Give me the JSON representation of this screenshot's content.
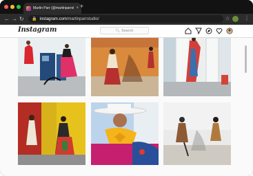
{
  "browser": {
    "tab_title": "Martin Parr (@martinparrstudio)",
    "tab_close": "×",
    "new_tab": "+",
    "url_host": "instagram.com",
    "url_path": "/martinparrstudio/",
    "back": "←",
    "forward": "→",
    "reload": "↻",
    "lock": "🔒",
    "bookmark": "☆",
    "menu": "⋮",
    "traffic_lights": [
      "#fe5f57",
      "#febc2e",
      "#28c840"
    ]
  },
  "instagram": {
    "logo": "Instagram",
    "search_placeholder": "Search",
    "nav_icons": [
      "home-icon",
      "send-icon",
      "explore-icon",
      "heart-icon",
      "profile-avatar"
    ]
  },
  "posts": [
    {
      "name": "post-red-dress-gas-pump",
      "palette": [
        "#e9eef1",
        "#d9262f",
        "#234a7a"
      ]
    },
    {
      "name": "post-women-shadow-wall",
      "palette": [
        "#d98a3d",
        "#b5302e",
        "#f1e4cf"
      ]
    },
    {
      "name": "post-white-doors",
      "palette": [
        "#ecefee",
        "#d2403a",
        "#3a6fb0"
      ]
    },
    {
      "name": "post-yellow-wall",
      "palette": [
        "#e8c21c",
        "#b32d24",
        "#ece7d6"
      ]
    },
    {
      "name": "post-white-hat-yellow-bow",
      "palette": [
        "#bcd4eb",
        "#f5b41b",
        "#c5206f"
      ]
    },
    {
      "name": "post-white-stone-wall",
      "palette": [
        "#eaeaea",
        "#8c5a35",
        "#2f2f2f"
      ]
    }
  ]
}
